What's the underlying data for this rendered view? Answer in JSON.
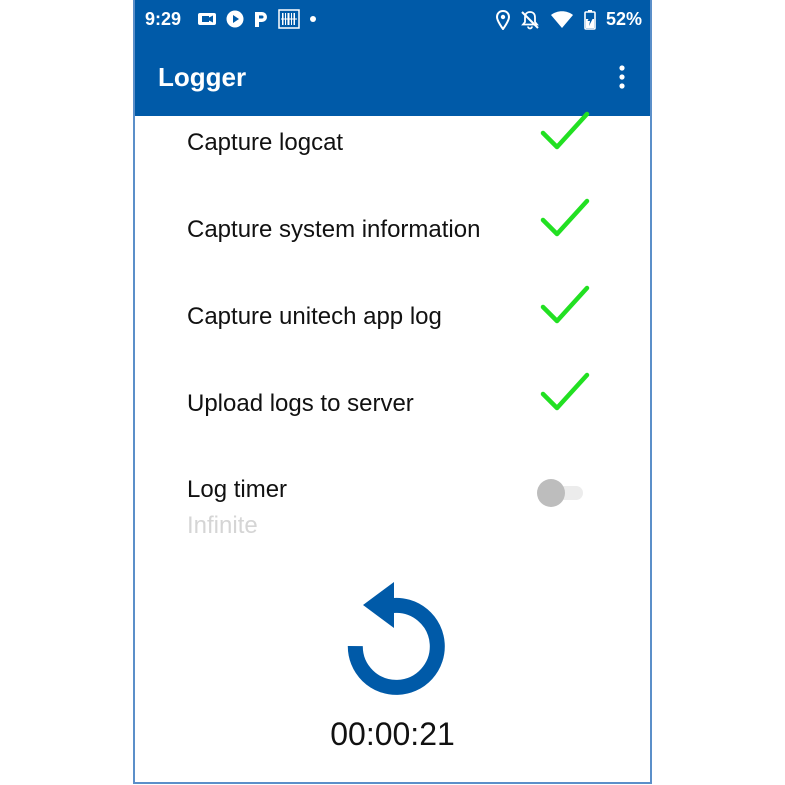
{
  "status_bar": {
    "time": "9:29",
    "left_icons": [
      "camera-icon",
      "play-icon",
      "parking-icon",
      "barcode-icon",
      "dot-icon"
    ],
    "right_icons": [
      "location-icon",
      "notifications-off-icon",
      "wifi-icon",
      "battery-icon"
    ],
    "battery": "52%"
  },
  "app_bar": {
    "title": "Logger",
    "menu_icon": "more-vert-icon"
  },
  "settings": [
    {
      "label": "Capture logcat",
      "checked": true
    },
    {
      "label": "Capture system information",
      "checked": true
    },
    {
      "label": "Capture unitech app log",
      "checked": true
    },
    {
      "label": "Upload logs to server",
      "checked": true
    }
  ],
  "log_timer": {
    "label": "Log timer",
    "value": "Infinite",
    "enabled": false
  },
  "action": {
    "icon": "refresh-icon"
  },
  "timer": "00:00:21",
  "colors": {
    "primary": "#005aa8",
    "check": "#22e022",
    "disabled_text": "#d5d5d5",
    "toggle_off": "#bdbdbd"
  }
}
